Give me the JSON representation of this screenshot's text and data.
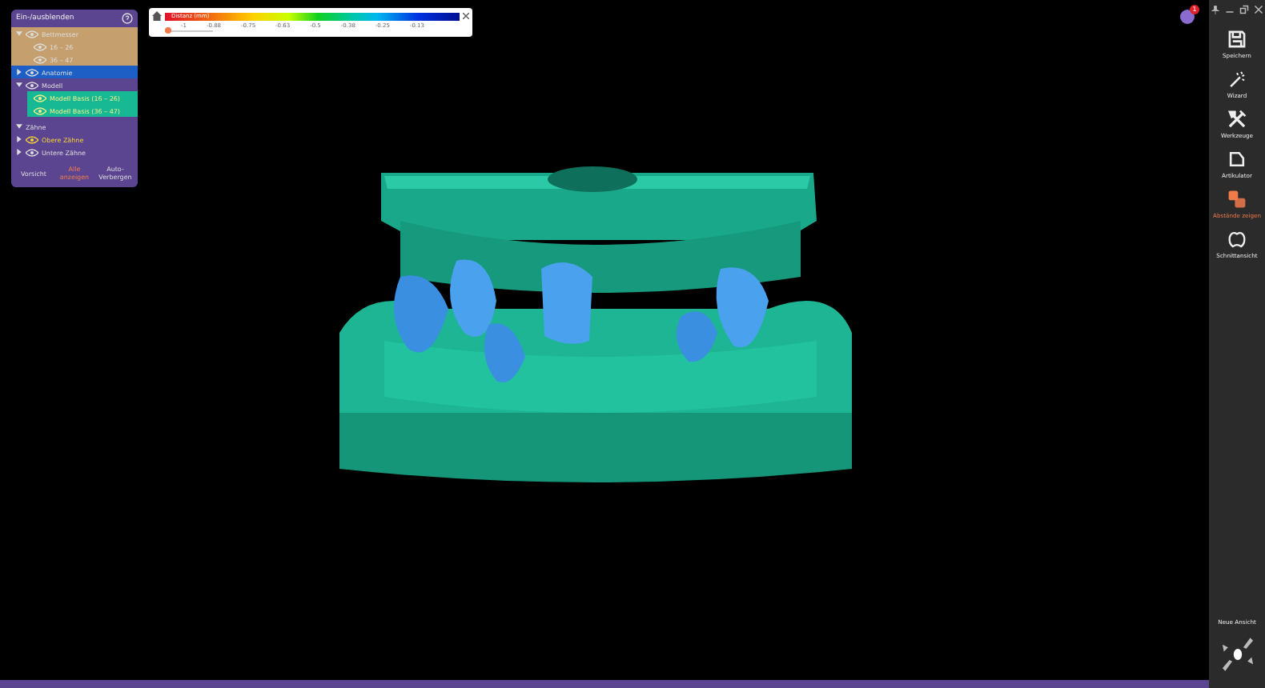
{
  "visibility_panel": {
    "title": "Ein-/ausblenden",
    "groups": [
      {
        "label": "Bettmesser",
        "kind": "tan",
        "expanded": true,
        "children": [
          {
            "label": "16 – 26"
          },
          {
            "label": "36 – 47"
          }
        ]
      },
      {
        "label": "Anatomie",
        "kind": "blue",
        "expanded": false
      },
      {
        "label": "Modell",
        "kind": "plain",
        "expanded": true,
        "children": [
          {
            "label": "Modell Basis (16 – 26)",
            "kind": "green"
          },
          {
            "label": "Modell Basis (36 – 47)",
            "kind": "green"
          }
        ]
      },
      {
        "label": "Zähne",
        "kind": "header",
        "expanded": true
      },
      {
        "label": "Obere Zähne",
        "kind": "yellow",
        "expanded": false
      },
      {
        "label": "Untere Zähne",
        "kind": "plain",
        "expanded": false
      }
    ],
    "buttons": [
      {
        "label": "Vorsicht",
        "kind": "plain"
      },
      {
        "label": "Alle anzeigen",
        "kind": "accent"
      },
      {
        "label": "Auto-Verbergen",
        "kind": "plain"
      }
    ]
  },
  "color_scale": {
    "caption": "Distanz (mm)",
    "ticks": [
      "-1",
      "-0.88",
      "-0.75",
      "-0.63",
      "-0.5",
      "-0.38",
      "-0.25",
      "-0.13"
    ],
    "level": 0.05
  },
  "notifications": {
    "badge": "1"
  },
  "toolbar": {
    "items": [
      {
        "label": "Speichern",
        "selected": false
      },
      {
        "label": "Wizard",
        "selected": false
      },
      {
        "label": "Werkzeuge",
        "selected": false
      },
      {
        "label": "Artikulator",
        "selected": false
      },
      {
        "label": "Abstände zeigen",
        "selected": true
      },
      {
        "label": "Schnittansicht",
        "selected": false
      }
    ],
    "view_label": "Neue Ansicht"
  }
}
